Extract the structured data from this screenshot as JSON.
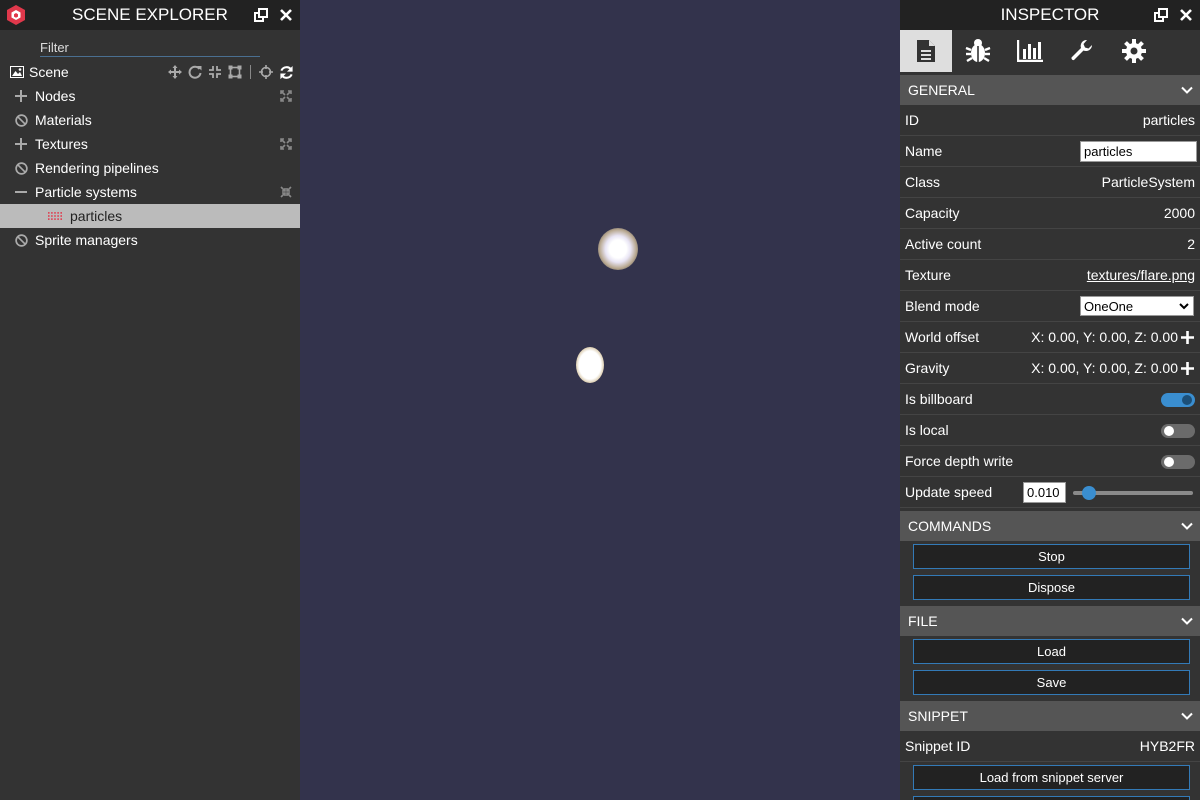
{
  "explorer": {
    "title": "SCENE EXPLORER",
    "filter_placeholder": "Filter",
    "scene_label": "Scene",
    "items": [
      {
        "label": "Nodes"
      },
      {
        "label": "Materials"
      },
      {
        "label": "Textures"
      },
      {
        "label": "Rendering pipelines"
      },
      {
        "label": "Particle systems"
      },
      {
        "label": "particles"
      },
      {
        "label": "Sprite managers"
      }
    ]
  },
  "inspector": {
    "title": "INSPECTOR",
    "tabs": [
      "properties-icon",
      "debug-icon",
      "statistics-icon",
      "tools-icon",
      "settings-icon"
    ],
    "sections": {
      "general": "GENERAL",
      "commands": "COMMANDS",
      "file": "FILE",
      "snippet": "SNIPPET"
    },
    "props": {
      "id_label": "ID",
      "id_value": "particles",
      "name_label": "Name",
      "name_value": "particles",
      "class_label": "Class",
      "class_value": "ParticleSystem",
      "capacity_label": "Capacity",
      "capacity_value": "2000",
      "active_label": "Active count",
      "active_value": "2",
      "texture_label": "Texture",
      "texture_value": "textures/flare.png",
      "blend_label": "Blend mode",
      "blend_value": "OneOne",
      "offset_label": "World offset",
      "offset_value": "X: 0.00, Y: 0.00, Z: 0.00",
      "gravity_label": "Gravity",
      "gravity_value": "X: 0.00, Y: 0.00, Z: 0.00",
      "billboard_label": "Is billboard",
      "billboard_on": true,
      "local_label": "Is local",
      "local_on": false,
      "depth_label": "Force depth write",
      "depth_on": false,
      "speed_label": "Update speed",
      "speed_value": "0.010",
      "speed_fraction": 0.1,
      "snippet_label": "Snippet ID",
      "snippet_value": "HYB2FR"
    },
    "buttons": {
      "stop": "Stop",
      "dispose": "Dispose",
      "load": "Load",
      "save": "Save",
      "load_snippet": "Load from snippet server"
    }
  },
  "colors": {
    "accent": "#3a8ed0",
    "panel": "#333333",
    "header": "#222222",
    "section": "#555555",
    "viewport": "#33334c",
    "logo": "#e0384b"
  }
}
